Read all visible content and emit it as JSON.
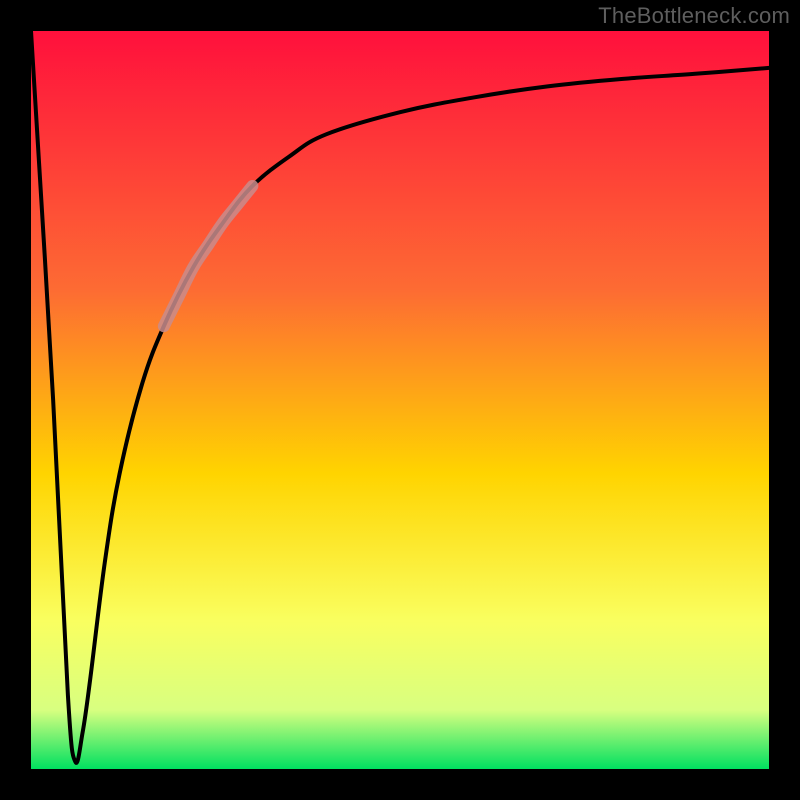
{
  "watermark": "TheBottleneck.com",
  "colors": {
    "frame": "#000000",
    "gradient_top": "#ff103c",
    "gradient_mid1": "#fd6b33",
    "gradient_mid2": "#ffd400",
    "gradient_mid3": "#f9ff60",
    "gradient_mid4": "#d8ff80",
    "gradient_bottom": "#00e060",
    "curve_main": "#000000",
    "curve_highlight": "#c98c8c"
  },
  "chart_data": {
    "type": "line",
    "title": "",
    "xlabel": "",
    "ylabel": "",
    "xlim": [
      0,
      100
    ],
    "ylim": [
      0,
      100
    ],
    "grid": false,
    "legend_position": "none",
    "series": [
      {
        "name": "bottleneck-curve",
        "x": [
          0,
          3,
          5,
          6,
          7,
          8,
          10,
          12,
          15,
          18,
          22,
          26,
          30,
          35,
          40,
          50,
          60,
          70,
          80,
          90,
          100
        ],
        "values": [
          100,
          50,
          10,
          1,
          5,
          12,
          28,
          40,
          52,
          60,
          68,
          74,
          79,
          83,
          86,
          89,
          91,
          92.5,
          93.5,
          94.2,
          95
        ]
      },
      {
        "name": "highlight-segment",
        "x": [
          18,
          20,
          22,
          24,
          26,
          28,
          30
        ],
        "values": [
          60,
          64,
          68,
          71,
          74,
          76.5,
          79
        ]
      }
    ],
    "annotations": []
  }
}
